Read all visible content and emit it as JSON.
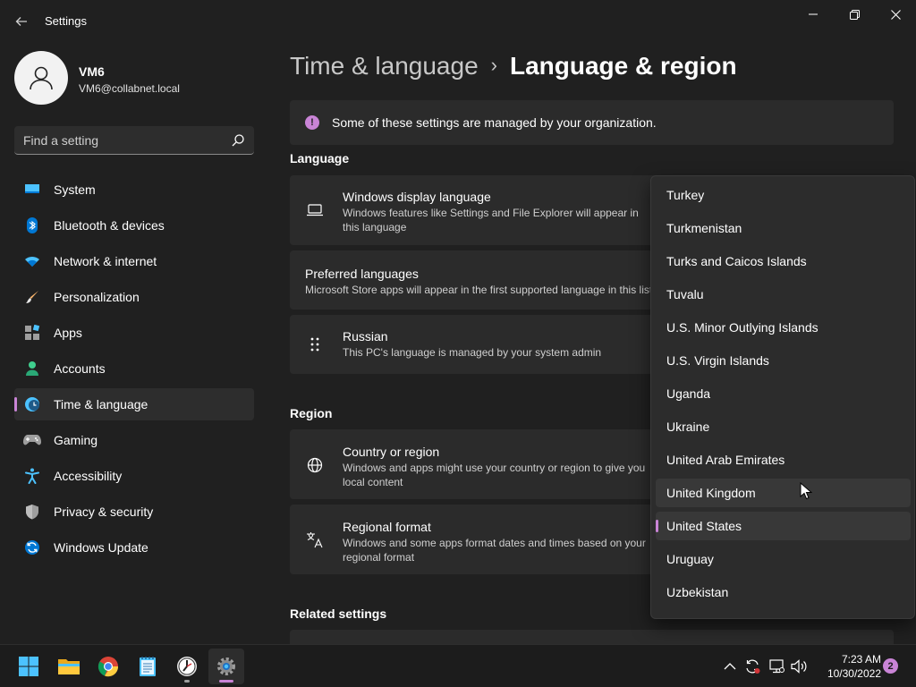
{
  "window": {
    "app_title": "Settings",
    "back_icon": "arrow-left-icon",
    "controls": [
      "minimize-icon",
      "maximize-icon",
      "close-icon"
    ]
  },
  "profile": {
    "name": "VM6",
    "email": "VM6@collabnet.local"
  },
  "search": {
    "placeholder": "Find a setting"
  },
  "sidebar": {
    "items": [
      {
        "label": "System",
        "icon": "monitor-icon",
        "active": false
      },
      {
        "label": "Bluetooth & devices",
        "icon": "bluetooth-icon",
        "active": false
      },
      {
        "label": "Network & internet",
        "icon": "wifi-icon",
        "active": false
      },
      {
        "label": "Personalization",
        "icon": "brush-icon",
        "active": false
      },
      {
        "label": "Apps",
        "icon": "apps-icon",
        "active": false
      },
      {
        "label": "Accounts",
        "icon": "person-icon",
        "active": false
      },
      {
        "label": "Time & language",
        "icon": "clock-globe-icon",
        "active": true
      },
      {
        "label": "Gaming",
        "icon": "gamepad-icon",
        "active": false
      },
      {
        "label": "Accessibility",
        "icon": "accessibility-icon",
        "active": false
      },
      {
        "label": "Privacy & security",
        "icon": "shield-icon",
        "active": false
      },
      {
        "label": "Windows Update",
        "icon": "update-icon",
        "active": false
      }
    ]
  },
  "breadcrumb": {
    "parent": "Time & language",
    "separator": "›",
    "current": "Language & region"
  },
  "info_bar": {
    "text": "Some of these settings are managed by your organization."
  },
  "sections": {
    "language": "Language",
    "region": "Region",
    "related": "Related settings"
  },
  "cards": {
    "display_language": {
      "title": "Windows display language",
      "desc": "Windows features like Settings and File Explorer will appear in this language"
    },
    "preferred_languages": {
      "title": "Preferred languages",
      "desc": "Microsoft Store apps will appear in the first supported language in this list"
    },
    "russian": {
      "title": "Russian",
      "desc": "This PC's language is managed by your system admin"
    },
    "country_region": {
      "title": "Country or region",
      "desc": "Windows and apps might use your country or region to give you local content"
    },
    "regional_format": {
      "title": "Regional format",
      "desc": "Windows and some apps format dates and times based on your regional format"
    }
  },
  "dropdown": {
    "items": [
      "Turkey",
      "Turkmenistan",
      "Turks and Caicos Islands",
      "Tuvalu",
      "U.S. Minor Outlying Islands",
      "U.S. Virgin Islands",
      "Uganda",
      "Ukraine",
      "United Arab Emirates",
      "United Kingdom",
      "United States",
      "Uruguay",
      "Uzbekistan"
    ],
    "hovered": "United Kingdom",
    "selected": "United States"
  },
  "taskbar": {
    "apps": [
      "windows-start-icon",
      "file-explorer-icon",
      "chrome-icon",
      "notepad-icon",
      "clock-app-icon",
      "settings-icon"
    ],
    "active_app": "settings-icon",
    "tray": [
      "chevron-up-icon",
      "sync-icon",
      "network-icon",
      "volume-icon"
    ],
    "time": "7:23 AM",
    "date": "10/30/2022",
    "notifications": "2"
  },
  "colors": {
    "background": "#202020",
    "card": "#2b2b2b",
    "accent": "#c984d6",
    "taskbar": "#1c1c1c"
  }
}
